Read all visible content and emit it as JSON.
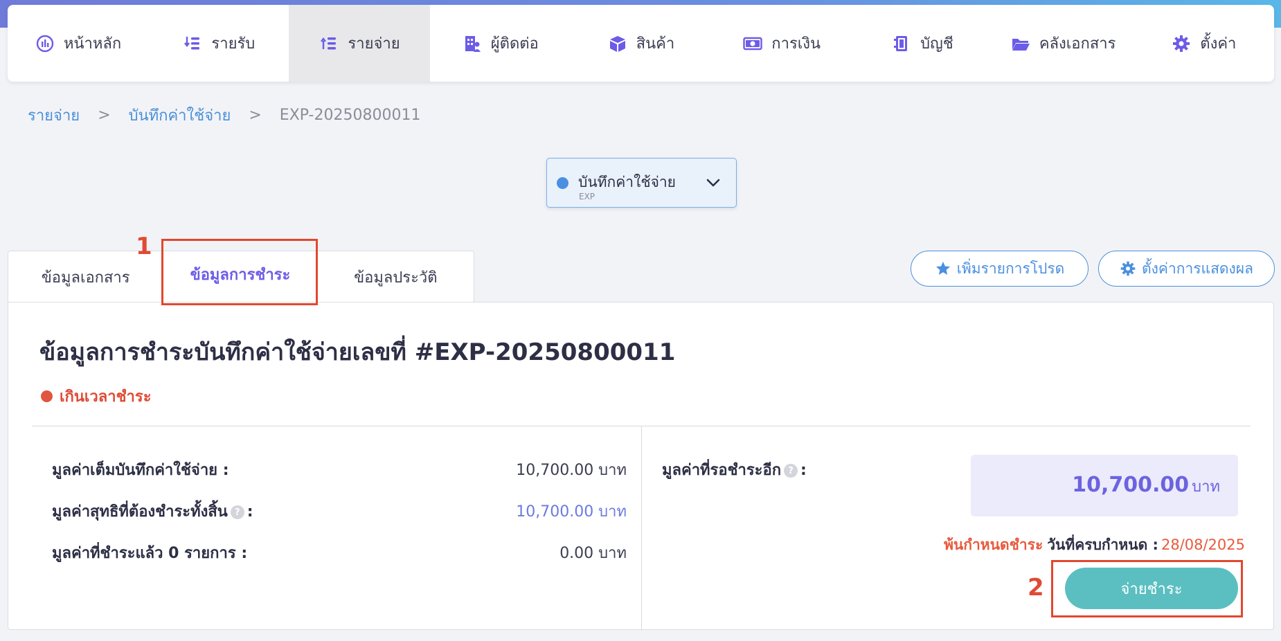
{
  "nav": {
    "items": [
      {
        "label": "หน้าหลัก",
        "icon": "dashboard-icon"
      },
      {
        "label": "รายรับ",
        "icon": "income-icon"
      },
      {
        "label": "รายจ่าย",
        "icon": "expense-icon",
        "active": true
      },
      {
        "label": "ผู้ติดต่อ",
        "icon": "contacts-icon"
      },
      {
        "label": "สินค้า",
        "icon": "box-icon"
      },
      {
        "label": "การเงิน",
        "icon": "money-icon"
      },
      {
        "label": "บัญชี",
        "icon": "ledger-icon"
      },
      {
        "label": "คลังเอกสาร",
        "icon": "folder-icon"
      },
      {
        "label": "ตั้งค่า",
        "icon": "gear-icon"
      }
    ]
  },
  "breadcrumb": {
    "root": "รายจ่าย",
    "parent": "บันทึกค่าใช้จ่าย",
    "current": "EXP-20250800011",
    "separator": ">"
  },
  "doc_type": {
    "label": "บันทึกค่าใช้จ่าย",
    "code": "EXP"
  },
  "tabs": {
    "document": "ข้อมูลเอกสาร",
    "payment": "ข้อมูลการชำระ",
    "history": "ข้อมูลประวัติ",
    "active": "payment"
  },
  "annotations": {
    "tab_marker": "1",
    "button_marker": "2"
  },
  "actions": {
    "favorite": "เพิ่มรายการโปรด",
    "display_settings": "ตั้งค่าการแสดงผล"
  },
  "payment": {
    "title": "ข้อมูลการชำระบันทึกค่าใช้จ่ายเลขที่ #EXP-20250800011",
    "status": "เกินเวลาชำระ",
    "full_value_label": "มูลค่าเต็มบันทึกค่าใช้จ่าย :",
    "full_value": "10,700.00 บาท",
    "net_value_label": "มูลค่าสุทธิที่ต้องชำระทั้งสิ้น",
    "net_value": "10,700.00 บาท",
    "paid_label": "มูลค่าที่ชำระแล้ว 0 รายการ :",
    "paid_value": "0.00 บาท",
    "pending_label": "มูลค่าที่รอชำระอีก",
    "pending_amount": "10,700.00",
    "pending_currency": "บาท",
    "overdue_text": "พ้นกำหนดชำระ",
    "due_label": "วันที่ครบกำหนด :",
    "due_date": "28/08/2025",
    "pay_button": "จ่ายชำระ",
    "help_glyph": "?",
    "colon": ":"
  },
  "colors": {
    "accent_purple": "#6c5ce7",
    "link_blue": "#4a90d9",
    "overdue_red": "#e85a3c",
    "pay_teal": "#5bbfc1",
    "highlight_red": "#e2472e"
  }
}
